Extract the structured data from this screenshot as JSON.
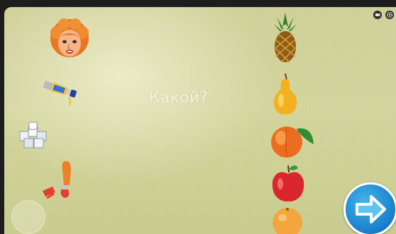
{
  "app": {
    "question_text": "Какой?"
  },
  "left_items": [
    {
      "icon": "woman-face-icon"
    },
    {
      "icon": "paint-tube-icon"
    },
    {
      "icon": "sugar-cubes-icon"
    },
    {
      "icon": "paintbrush-icon"
    }
  ],
  "right_items": [
    {
      "icon": "pineapple-icon"
    },
    {
      "icon": "pear-icon"
    },
    {
      "icon": "peach-icon"
    },
    {
      "icon": "apple-icon"
    },
    {
      "icon": "orange-icon"
    }
  ],
  "controls": {
    "top_right": [
      "record-icon",
      "settings-icon"
    ],
    "next_button_icon": "arrow-right-icon"
  },
  "colors": {
    "next_button": "#1e8fd6",
    "question_text": "#f3f1dc",
    "background": "#d3d49c"
  }
}
